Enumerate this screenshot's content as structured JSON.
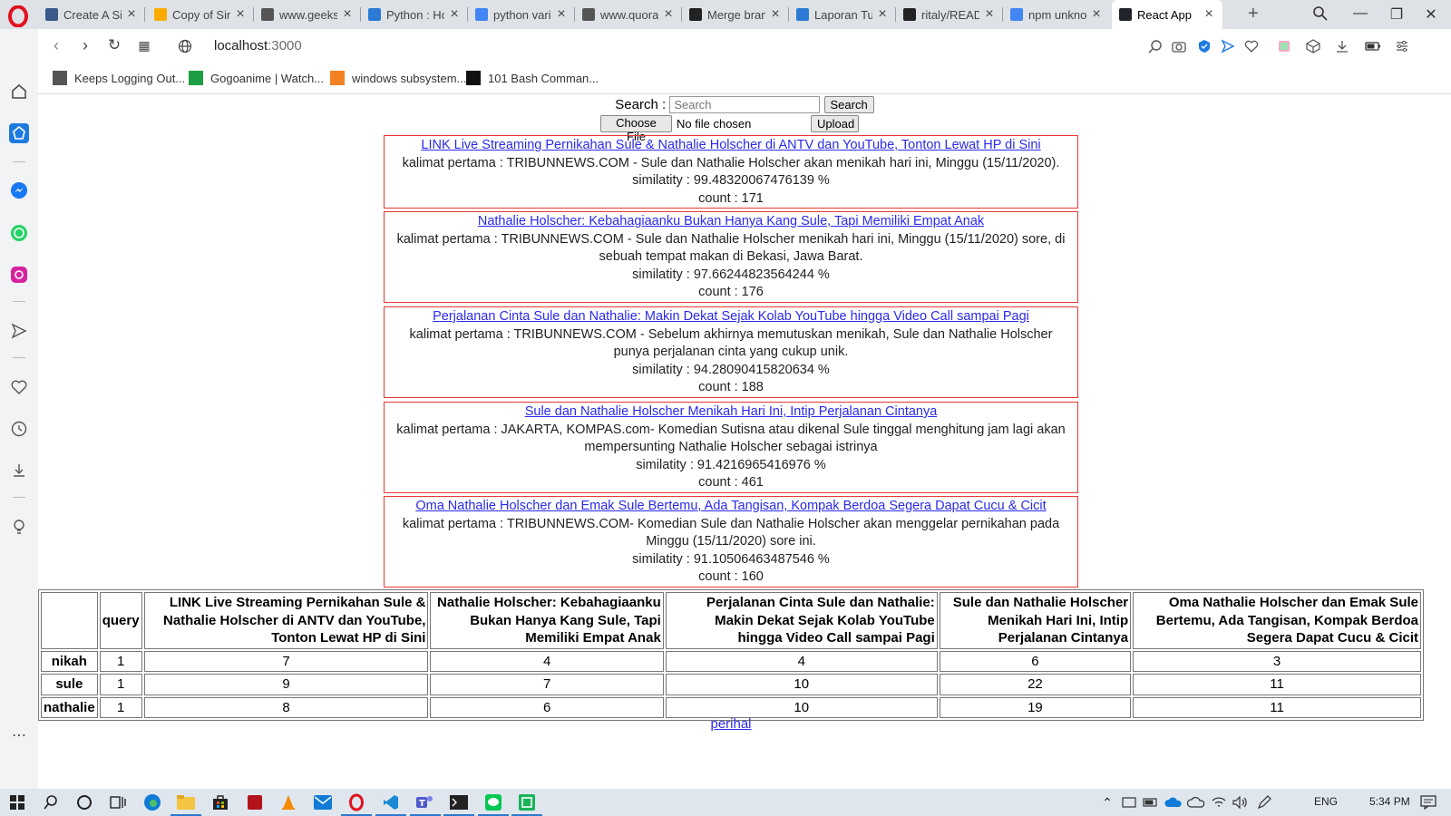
{
  "browser": {
    "tabs": [
      {
        "label": "Create A Si",
        "icon": "tds-icon",
        "color": "#3a5a8c"
      },
      {
        "label": "Copy of Sin",
        "icon": "colab-icon",
        "color": "#f9ab00"
      },
      {
        "label": "www.geeksf",
        "icon": "page-icon",
        "color": "#555555"
      },
      {
        "label": "Python : Ho",
        "icon": "python-icon",
        "color": "#2b7bd6"
      },
      {
        "label": "python vari",
        "icon": "google-icon",
        "color": "#4285f4"
      },
      {
        "label": "www.quora",
        "icon": "page-icon",
        "color": "#555555"
      },
      {
        "label": "Merge bran",
        "icon": "github-icon",
        "color": "#222222"
      },
      {
        "label": "Laporan Tu",
        "icon": "docs-icon",
        "color": "#2b7bd6"
      },
      {
        "label": "ritaly/READ",
        "icon": "github-icon",
        "color": "#222222"
      },
      {
        "label": "npm unkno",
        "icon": "google-icon",
        "color": "#4285f4"
      },
      {
        "label": "React App",
        "icon": "react-icon",
        "color": "#20232a"
      }
    ],
    "new_tab": "+",
    "url_host": "localhost",
    "url_port": ":3000",
    "bookmarks": [
      {
        "label": "Keeps Logging Out...",
        "icon": "page-icon"
      },
      {
        "label": "Gogoanime | Watch...",
        "icon": "gogoanime-icon"
      },
      {
        "label": "windows subsystem...",
        "icon": "stackoverflow-icon"
      },
      {
        "label": "101 Bash Comman...",
        "icon": "dev-icon"
      }
    ]
  },
  "search": {
    "label": "Search :",
    "placeholder": "Search",
    "button": "Search"
  },
  "upload": {
    "choose_button": "Choose File",
    "file_status": "No file chosen",
    "upload_button": "Upload"
  },
  "results": [
    {
      "title": "LINK Live Streaming Pernikahan Sule & Nathalie Holscher di ANTV dan YouTube, Tonton Lewat HP di Sini",
      "sentence": "kalimat pertama : TRIBUNNEWS.COM - Sule dan Nathalie Holscher akan menikah hari ini, Minggu (15/11/2020).",
      "similarity": "similatity : 99.48320067476139 %",
      "count": "count : 171"
    },
    {
      "title": "Nathalie Holscher: Kebahagiaanku Bukan Hanya Kang Sule, Tapi Memiliki Empat Anak",
      "sentence": "kalimat pertama : TRIBUNNEWS.COM - Sule dan Nathalie Holscher menikah hari ini, Minggu (15/11/2020) sore, di sebuah tempat makan di Bekasi, Jawa Barat.",
      "similarity": "similatity : 97.66244823564244 %",
      "count": "count : 176"
    },
    {
      "title": "Perjalanan Cinta Sule dan Nathalie: Makin Dekat Sejak Kolab YouTube hingga Video Call sampai Pagi",
      "sentence": "kalimat pertama : TRIBUNNEWS.COM - Sebelum akhirnya memutuskan menikah, Sule dan Nathalie Holscher punya perjalanan cinta yang cukup unik.",
      "similarity": "similatity : 94.28090415820634 %",
      "count": "count : 188"
    },
    {
      "title": "Sule dan Nathalie Holscher Menikah Hari Ini, Intip Perjalanan Cintanya",
      "sentence": "kalimat pertama : JAKARTA, KOMPAS.com- Komedian Sutisna atau dikenal Sule tinggal menghitung jam lagi akan mempersunting Nathalie Holscher sebagai istrinya",
      "similarity": "similatity : 91.4216965416976 %",
      "count": "count : 461"
    },
    {
      "title": "Oma Nathalie Holscher dan Emak Sule Bertemu, Ada Tangisan, Kompak Berdoa Segera Dapat Cucu & Cicit",
      "sentence": "kalimat pertama : TRIBUNNEWS.COM- Komedian Sule dan Nathalie Holscher akan menggelar pernikahan pada Minggu (15/11/2020) sore ini.",
      "similarity": "similatity : 91.10506463487546 %",
      "count": "count : 160"
    }
  ],
  "table": {
    "corner": "",
    "headers": [
      "query",
      "LINK Live Streaming Pernikahan Sule & Nathalie Holscher di ANTV dan YouTube, Tonton Lewat HP di Sini",
      "Nathalie Holscher: Kebahagiaanku Bukan Hanya Kang Sule, Tapi Memiliki Empat Anak",
      "Perjalanan Cinta Sule dan Nathalie: Makin Dekat Sejak Kolab YouTube hingga Video Call sampai Pagi",
      "Sule dan Nathalie Holscher Menikah Hari Ini, Intip Perjalanan Cintanya",
      "Oma Nathalie Holscher dan Emak Sule Bertemu, Ada Tangisan, Kompak Berdoa Segera Dapat Cucu & Cicit"
    ],
    "rows": [
      {
        "term": "nikah",
        "values": [
          "1",
          "7",
          "4",
          "4",
          "6",
          "3"
        ]
      },
      {
        "term": "sule",
        "values": [
          "1",
          "9",
          "7",
          "10",
          "22",
          "11"
        ]
      },
      {
        "term": "nathalie",
        "values": [
          "1",
          "8",
          "6",
          "10",
          "19",
          "11"
        ]
      }
    ]
  },
  "footer_link": "perihal",
  "taskbar": {
    "language": "ENG",
    "time": "5:34 PM"
  }
}
